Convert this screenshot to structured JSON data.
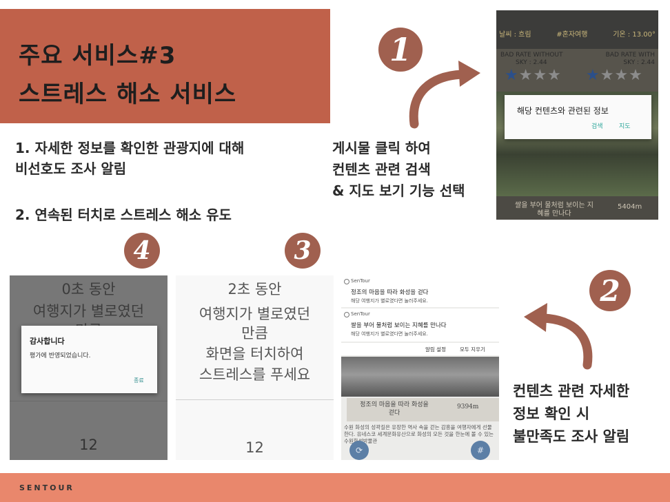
{
  "title": {
    "line1": "주요 서비스#3",
    "line2": "스트레스 해소 서비스"
  },
  "description": {
    "item1_line1": "1. 자세한 정보를 확인한 관광지에 대해",
    "item1_line2": "비선호도 조사 알림",
    "item2": "2. 연속된 터치로 스트레스 해소 유도"
  },
  "steps": {
    "step1_badge": "1",
    "step1_lines": [
      "게시물 클릭 하여",
      "컨텐츠 관련 검색",
      "& 지도 보기 기능 선택"
    ],
    "step2_badge": "2",
    "step2_lines": [
      "컨텐츠 관련 자세한",
      "정보 확인 시",
      "불만족도 조사 알림"
    ],
    "step3_badge": "3",
    "step4_badge": "4"
  },
  "screen1": {
    "weather": "날씨 : 흐림",
    "tag": "#혼자여행",
    "temperature": "기온 : 13.00°",
    "rate_without": "BAD RATE WITHOUT",
    "sky_left": "SKY : 2.44",
    "rate_with": "BAD RATE WITH",
    "sky_right": "SKY : 2.44",
    "dialog_title": "해당 컨텐츠와 관련된 정보",
    "btn_search": "검색",
    "btn_map": "지도",
    "place": "쌀을 부어 물처럼 보이는 지혜를 만나다",
    "distance": "5404m"
  },
  "screen2": {
    "app_name": "SenTour",
    "n1_title": "정조의 마음을 따라 화성을 걷다",
    "n1_sub": "해당 여행지가 별로였다면 눌러주세요.",
    "n2_title": "쌀을 부어 물처럼 보이는 지혜를 만나다",
    "n2_sub": "해당 여행지가 별로였다면 눌러주세요.",
    "settings": "알림 설정",
    "clear": "모두 지우기",
    "place": "정조의 마음을 따라 화성을 걷다",
    "distance": "9394m",
    "body": "수원 화성의 성곽길은 유장한 역사 속을 걷는 감흥을 여행자에게 선물한다. 유네스코 세계문화유산으로 화성의 모든 것을 한눈에 볼 수 있는 수원화성박물관"
  },
  "screen3": {
    "seconds": "2초 동안",
    "line1": "여행지가 별로였던",
    "line2": "만큼",
    "line3": "화면을 터치하여",
    "line4": "스트레스를 푸세요",
    "count": "12"
  },
  "screen4": {
    "seconds": "0초 동안",
    "line1": "여행지가 별로였던",
    "line2": "만큼",
    "dialog_title": "감사합니다",
    "dialog_msg": "평가에 반영되었습니다.",
    "dialog_btn": "종료",
    "count": "12"
  },
  "footer": {
    "brand": "SENTOUR"
  },
  "colors": {
    "title_bg": "#c0614a",
    "badge": "#a0604f",
    "footer_bg": "#e9876c"
  }
}
